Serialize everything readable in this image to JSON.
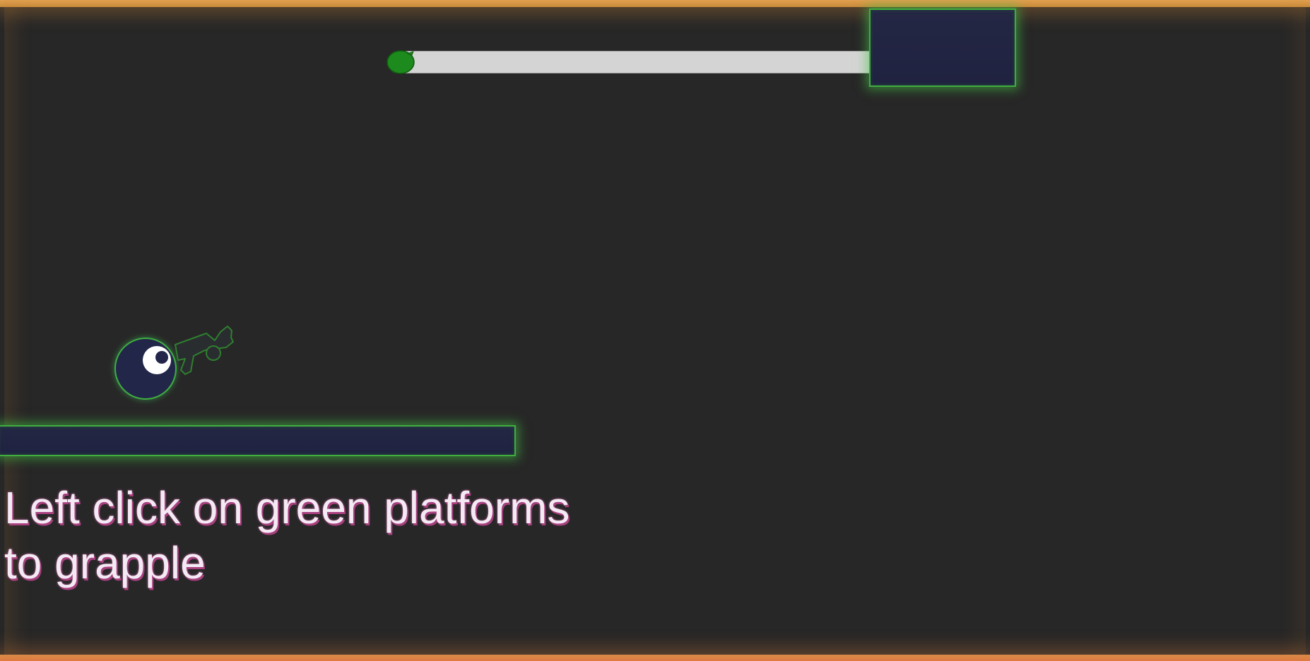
{
  "hint": {
    "line1": "Left click on green platforms",
    "line2": "to grapple"
  },
  "level_progress": {
    "fraction": 0.0
  },
  "colors": {
    "background": "#272727",
    "platform_fill": "#22253f",
    "platform_glow": "#3fae3f",
    "progress_track": "#d4d4d4",
    "progress_marker": "#1c8a1c",
    "hint_text": "#f4eaf4",
    "hint_shadow": "#a8407f",
    "border_glow": "#e0a050"
  },
  "icons": {
    "player": "player-ball-icon",
    "grapple_gun": "grapple-gun-icon",
    "progress_marker": "player-marker-icon"
  }
}
